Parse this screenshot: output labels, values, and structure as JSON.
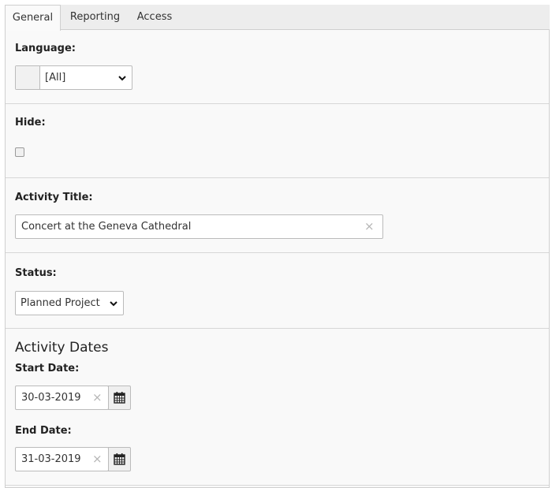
{
  "tabs": [
    {
      "label": "General",
      "active": true
    },
    {
      "label": "Reporting",
      "active": false
    },
    {
      "label": "Access",
      "active": false
    }
  ],
  "language": {
    "label": "Language:",
    "value": "[All]"
  },
  "hide": {
    "label": "Hide:",
    "checked": false
  },
  "activity_title": {
    "label": "Activity Title:",
    "value": "Concert at the Geneva Cathedral",
    "clear_glyph": "×"
  },
  "status": {
    "label": "Status:",
    "value": "Planned Project"
  },
  "activity_dates": {
    "heading": "Activity Dates",
    "start": {
      "label": "Start Date:",
      "value": "30-03-2019",
      "clear_glyph": "×",
      "icon": "calendar-icon"
    },
    "end": {
      "label": "End Date:",
      "value": "31-03-2019",
      "clear_glyph": "×",
      "icon": "calendar-icon"
    }
  }
}
